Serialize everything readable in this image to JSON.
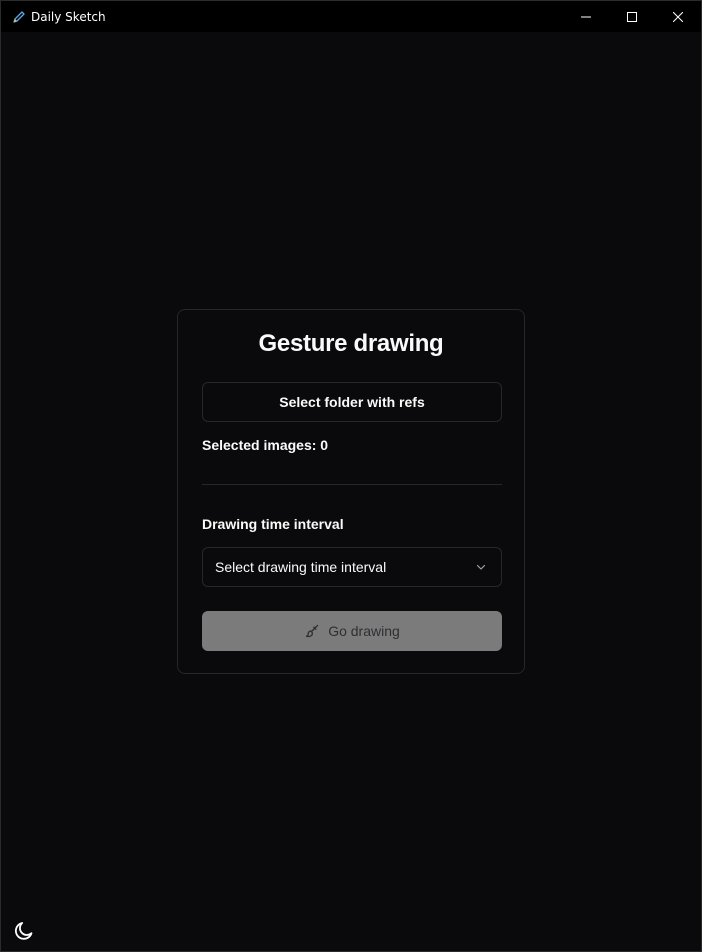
{
  "window": {
    "title": "Daily Sketch",
    "icon": "pencil-icon",
    "controls": [
      "minimize-icon",
      "maximize-icon",
      "close-icon"
    ]
  },
  "card": {
    "title": "Gesture drawing",
    "select_folder_label": "Select folder with refs",
    "selected_images_label": "Selected images: 0",
    "interval_label": "Drawing time interval",
    "interval_select": {
      "value": "Select drawing time interval",
      "icon": "chevron-down-icon"
    },
    "go_button": {
      "label": "Go drawing",
      "icon": "brush-icon",
      "disabled": true
    }
  },
  "theme_toggle": {
    "icon": "moon-icon"
  },
  "colors": {
    "background": "#0a0a0c",
    "border": "#27272a",
    "text": "#fafafa",
    "disabled_button": "#7b7b7b",
    "app_icon_accent": "#5aa9e6"
  }
}
